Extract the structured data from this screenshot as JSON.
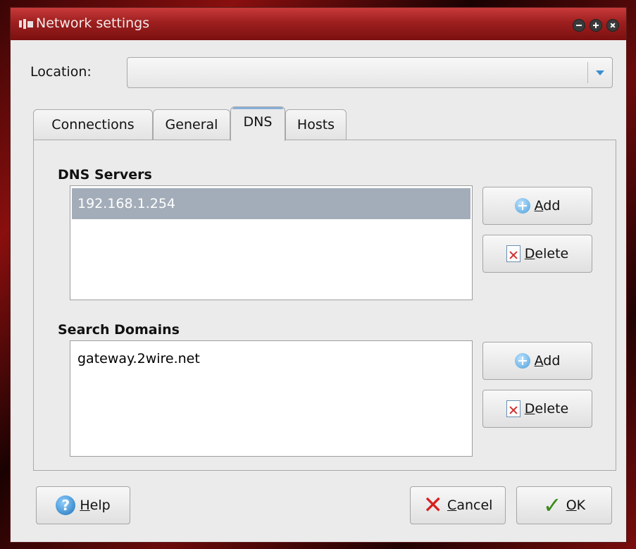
{
  "window": {
    "title": "Network settings"
  },
  "location": {
    "label": "Location:",
    "value": ""
  },
  "tabs": [
    {
      "label": "Connections"
    },
    {
      "label": "General"
    },
    {
      "label": "DNS"
    },
    {
      "label": "Hosts"
    }
  ],
  "dns_servers": {
    "title": "DNS Servers",
    "items": [
      "192.168.1.254"
    ],
    "add_prefix": "",
    "add_mnemonic": "A",
    "add_rest": "dd",
    "delete_mnemonic": "D",
    "delete_rest": "elete"
  },
  "search_domains": {
    "title": "Search Domains",
    "items": [
      "gateway.2wire.net"
    ],
    "add_mnemonic": "A",
    "add_rest": "dd",
    "delete_mnemonic": "D",
    "delete_rest": "elete"
  },
  "footer": {
    "help_mnemonic": "H",
    "help_rest": "elp",
    "cancel_mnemonic": "C",
    "cancel_rest": "ancel",
    "ok_mnemonic": "O",
    "ok_rest": "K"
  },
  "icons": {
    "app": "network-settings-icon",
    "minimize": "minimize-icon",
    "maximize": "maximize-icon",
    "close": "close-icon",
    "add": "plus-icon",
    "delete": "delete-icon",
    "help": "help-icon",
    "cancel": "cross-icon",
    "ok": "checkmark-icon"
  },
  "colors": {
    "titlebar": "#9e1f1f",
    "selected_row": "#a3adb9",
    "active_tab_accent": "#8aaed8",
    "combo_arrow": "#3a8fcf"
  }
}
